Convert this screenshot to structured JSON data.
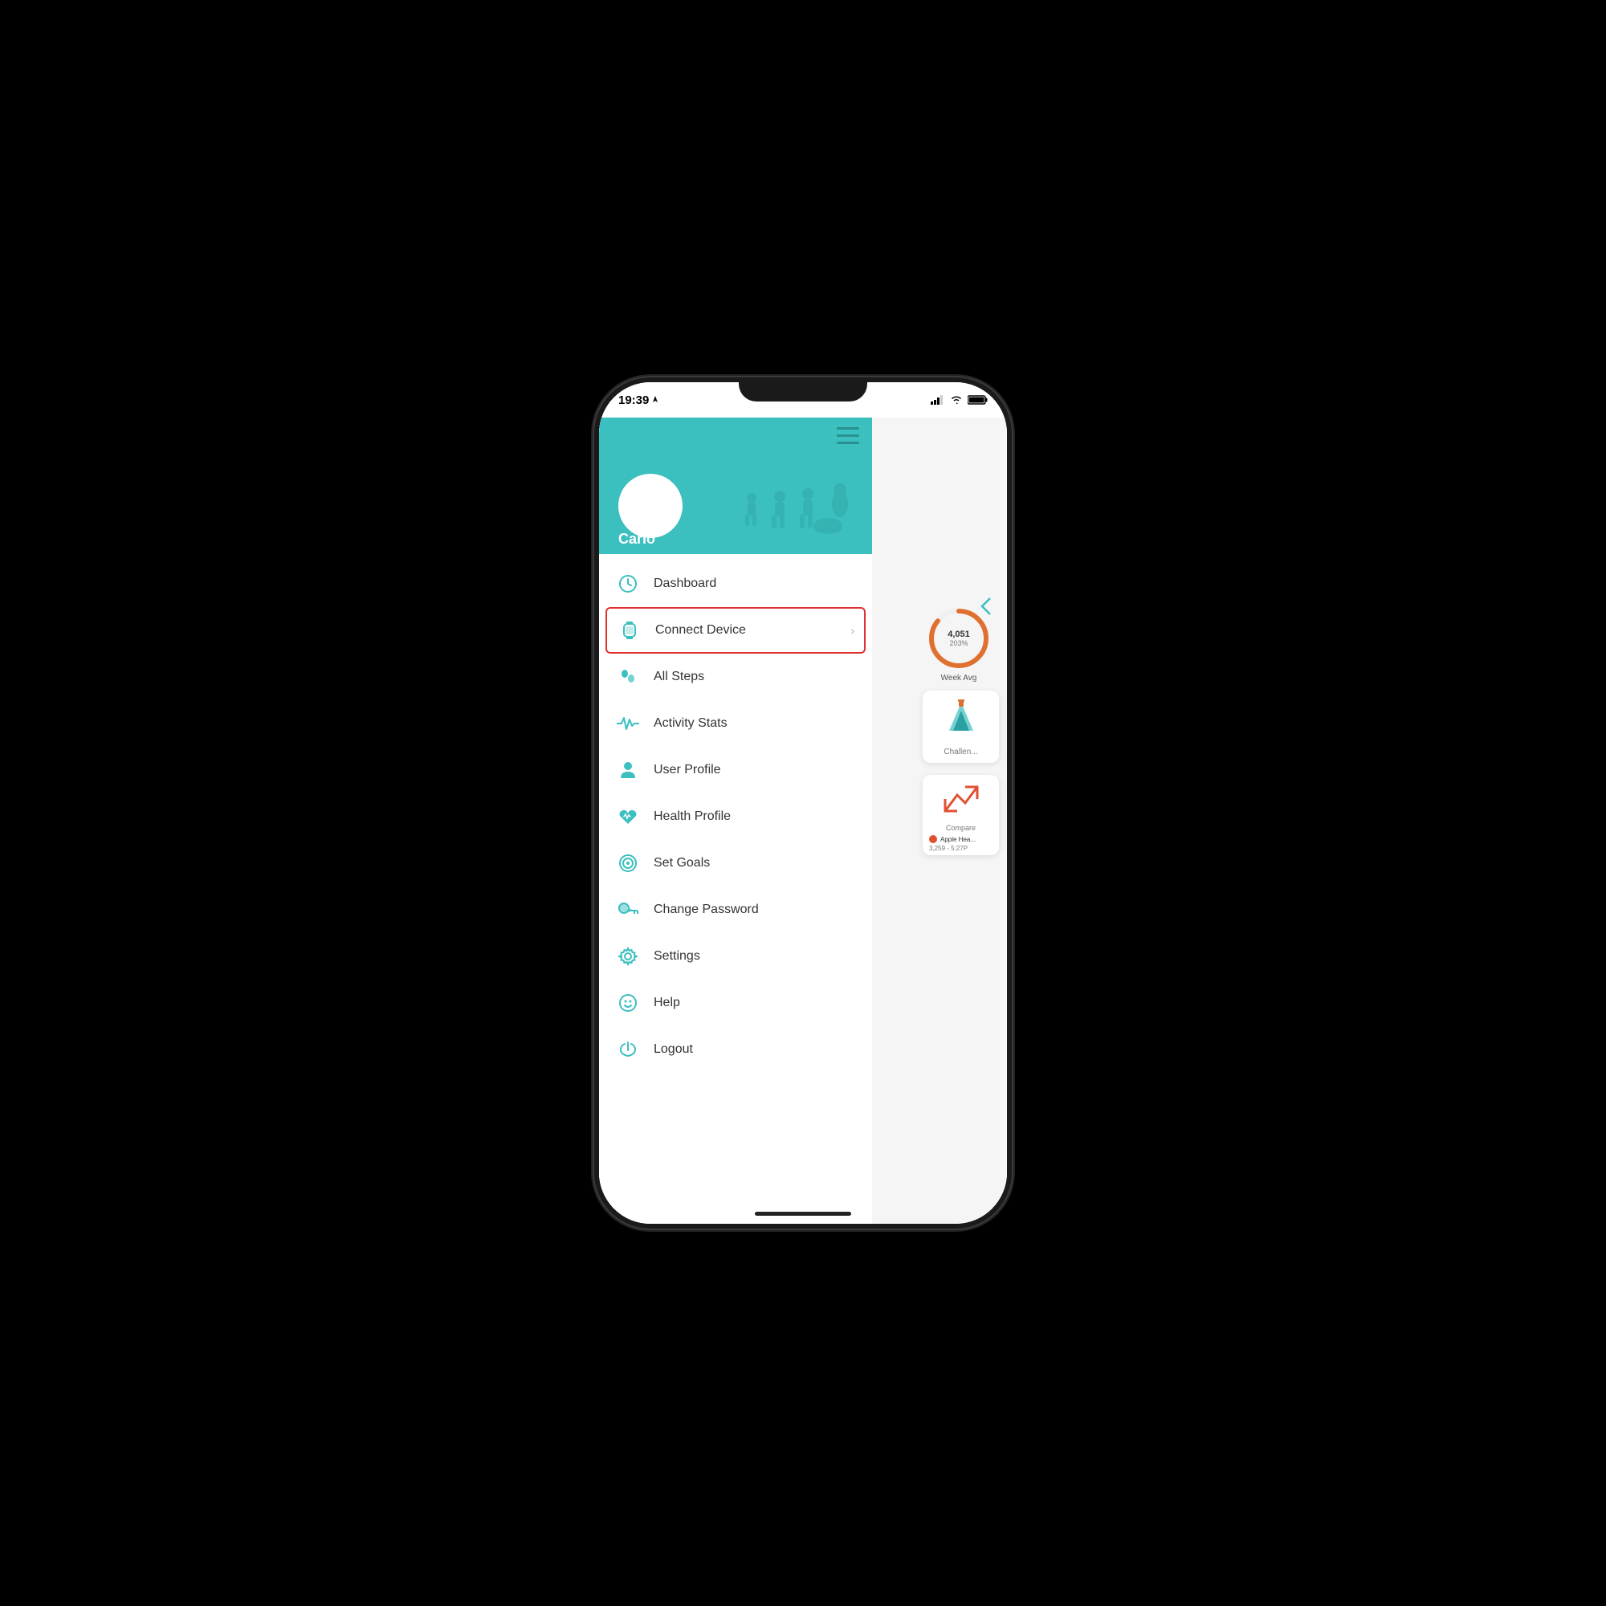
{
  "statusBar": {
    "time": "19:39",
    "locationArrow": true
  },
  "profile": {
    "name": "Carlo",
    "avatarAlt": "profile avatar"
  },
  "hamburger": {
    "label": "☰"
  },
  "menuItems": [
    {
      "id": "dashboard",
      "label": "Dashboard",
      "icon": "clock",
      "active": false,
      "hasArrow": false
    },
    {
      "id": "connect-device",
      "label": "Connect Device",
      "icon": "watch",
      "active": true,
      "hasArrow": true
    },
    {
      "id": "all-steps",
      "label": "All Steps",
      "icon": "steps",
      "active": false,
      "hasArrow": false
    },
    {
      "id": "activity-stats",
      "label": "Activity Stats",
      "icon": "pulse",
      "active": false,
      "hasArrow": false
    },
    {
      "id": "user-profile",
      "label": "User Profile",
      "icon": "person",
      "active": false,
      "hasArrow": false
    },
    {
      "id": "health-profile",
      "label": "Health Profile",
      "icon": "heart",
      "active": false,
      "hasArrow": false
    },
    {
      "id": "set-goals",
      "label": "Set Goals",
      "icon": "target",
      "active": false,
      "hasArrow": false
    },
    {
      "id": "change-password",
      "label": "Change Password",
      "icon": "key",
      "active": false,
      "hasArrow": false
    },
    {
      "id": "settings",
      "label": "Settings",
      "icon": "gear",
      "active": false,
      "hasArrow": false
    },
    {
      "id": "help",
      "label": "Help",
      "icon": "help",
      "active": false,
      "hasArrow": false
    },
    {
      "id": "logout",
      "label": "Logout",
      "icon": "power",
      "active": false,
      "hasArrow": false
    }
  ],
  "bgContent": {
    "steps": {
      "number": "4,051",
      "percent": "203%",
      "weekAvg": "Week Avg"
    },
    "challenge": {
      "label": "Challen..."
    },
    "compare": {
      "label": "Compare",
      "source": "Apple Hea...",
      "range": "3,259 - 5:27P"
    },
    "backArrow": "‹"
  },
  "colors": {
    "teal": "#3bbfbf",
    "orange": "#e07030",
    "red": "#e03030",
    "darkRed": "#cc2020"
  },
  "homeIndicator": ""
}
